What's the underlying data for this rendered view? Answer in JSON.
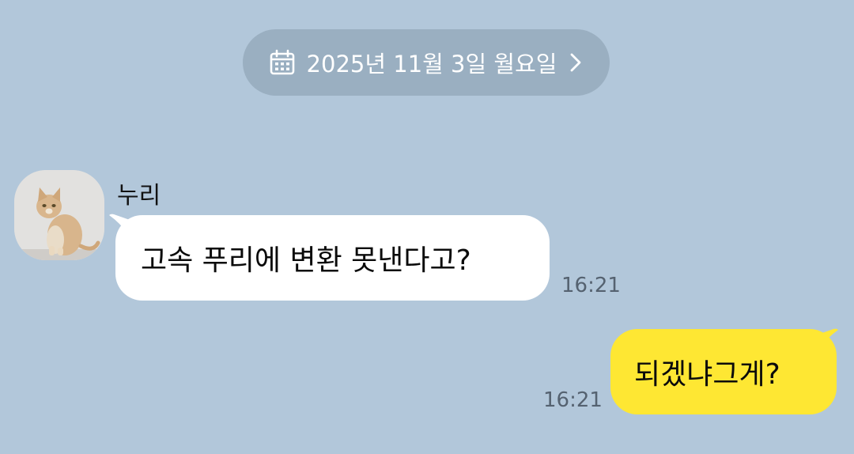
{
  "colors": {
    "background": "#B2C7DA",
    "date_pill": "#9AAFC1",
    "incoming_bubble": "#FFFFFF",
    "outgoing_bubble": "#FEE733",
    "timestamp": "#556270"
  },
  "date_divider": {
    "label": "2025년 11월 3일 월요일",
    "icon": "calendar-icon",
    "trailing_icon": "chevron-right-icon"
  },
  "messages": [
    {
      "direction": "incoming",
      "sender": "누리",
      "avatar": "cat-photo",
      "text": "고속 푸리에 변환 못낸다고?",
      "time": "16:21"
    },
    {
      "direction": "outgoing",
      "text": "되겠냐그게?",
      "time": "16:21"
    }
  ]
}
